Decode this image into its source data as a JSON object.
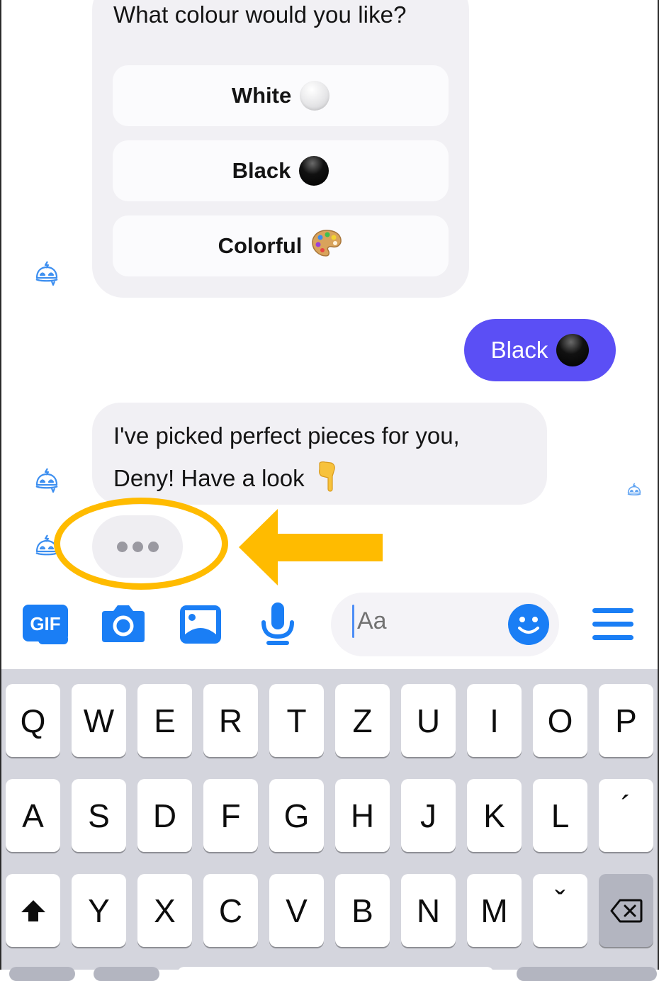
{
  "question_card": {
    "question": "What colour would you like?",
    "options": [
      {
        "label": "White",
        "icon": "white-circle-emoji"
      },
      {
        "label": "Black",
        "icon": "black-circle-emoji"
      },
      {
        "label": "Colorful",
        "icon": "artist-palette-emoji",
        "emoji": "🎨"
      }
    ]
  },
  "user_reply": {
    "label": "Black",
    "icon": "black-circle-emoji"
  },
  "bot_message": {
    "lines": [
      "I've picked perfect pieces for you,",
      "Deny!  Have a look"
    ],
    "emoji": "👇"
  },
  "typing_indicator": {
    "state": "typing"
  },
  "annotation": {
    "color": "#ffbb00",
    "shapes": [
      "ellipse",
      "left-arrow"
    ]
  },
  "composer": {
    "gif_label": "GIF",
    "placeholder": "Aa",
    "icons": [
      "gif-icon",
      "camera-icon",
      "image-icon",
      "microphone-icon",
      "emoji-smiley-icon",
      "menu-icon"
    ]
  },
  "keyboard": {
    "rows": [
      [
        "Q",
        "W",
        "E",
        "R",
        "T",
        "Z",
        "U",
        "I",
        "O",
        "P"
      ],
      [
        "A",
        "S",
        "D",
        "F",
        "G",
        "H",
        "J",
        "K",
        "L",
        "´"
      ],
      [
        "⬆",
        "Y",
        "X",
        "C",
        "V",
        "B",
        "N",
        "M",
        "ˇ",
        "⌫"
      ]
    ]
  },
  "colors": {
    "accent_purple": "#5b4ff5",
    "messenger_blue": "#1a7ef5",
    "bubble_gray": "#f1f0f4",
    "keyboard_bg": "#d4d5dd",
    "annotation_orange": "#ffbb00"
  }
}
